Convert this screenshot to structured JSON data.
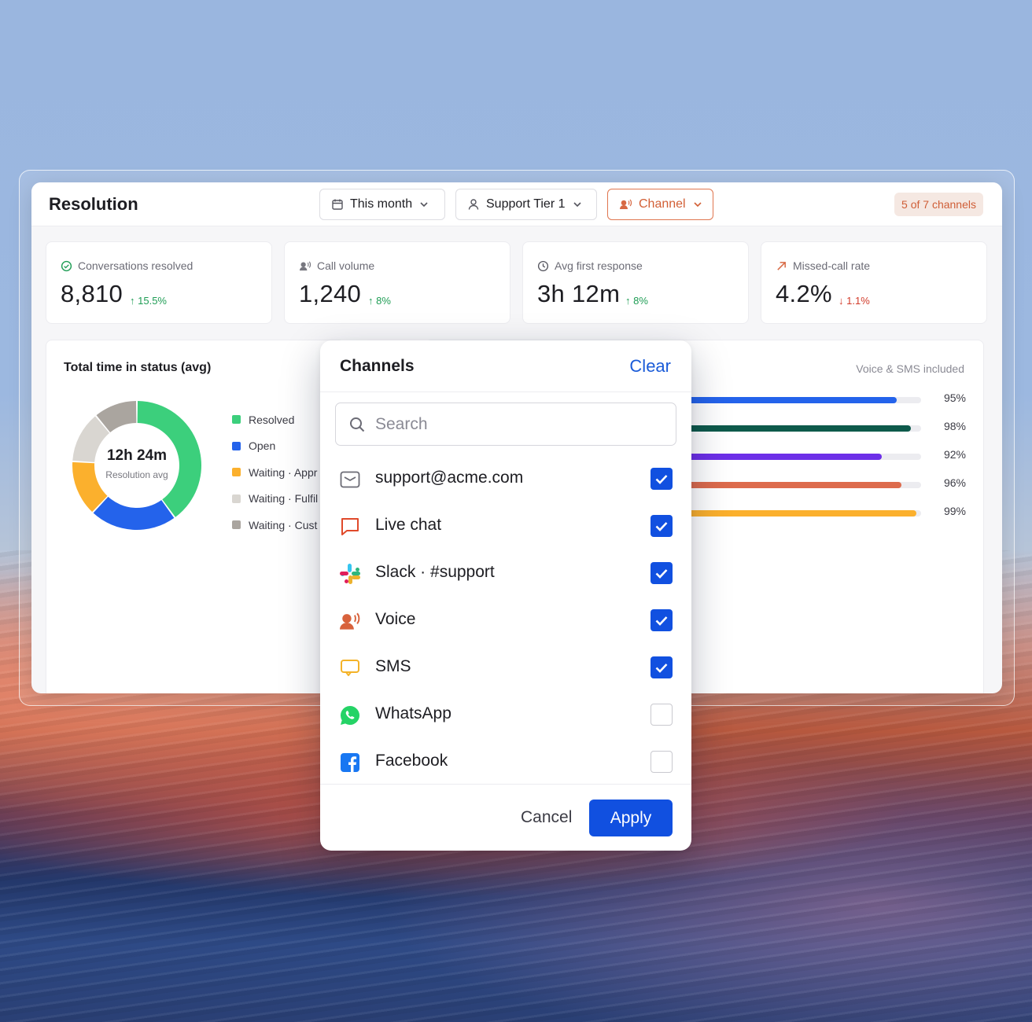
{
  "header": {
    "title": "Resolution",
    "filters": {
      "date": "This month",
      "team": "Support Tier 1",
      "channel": "Channel"
    },
    "channel_badge": "5 of 7 channels"
  },
  "kpis": [
    {
      "label": "Conversations resolved",
      "value": "8,810",
      "delta": "15.5%",
      "direction": "up",
      "icon": "check-circle-icon"
    },
    {
      "label": "Call volume",
      "value": "1,240",
      "delta": "8%",
      "direction": "up",
      "icon": "voice-icon"
    },
    {
      "label": "Avg first response",
      "value": "3h 12m",
      "delta": "8%",
      "direction": "up",
      "icon": "clock-icon"
    },
    {
      "label": "Missed-call rate",
      "value": "4.2%",
      "delta": "1.1%",
      "direction": "down",
      "icon": "arrow-up-right-icon"
    }
  ],
  "status_panel": {
    "title": "Total time in status (avg)",
    "center_value": "12h 24m",
    "center_label": "Resolution avg",
    "legend": [
      {
        "label": "Resolved",
        "color": "#3ccf7c"
      },
      {
        "label": "Open",
        "color": "#2463eb"
      },
      {
        "label": "Waiting · Appr",
        "color": "#fbb02d"
      },
      {
        "label": "Waiting · Fulfil",
        "color": "#d9d6d1"
      },
      {
        "label": "Waiting · Cust",
        "color": "#aaa59f"
      }
    ]
  },
  "chart_data": {
    "type": "pie",
    "categories": [
      "Resolved",
      "Open",
      "Waiting · Appr",
      "Waiting · Fulfil",
      "Waiting · Cust"
    ],
    "values": [
      40,
      22,
      14,
      13,
      11
    ],
    "colors": [
      "#3ccf7c",
      "#2463eb",
      "#fbb02d",
      "#d9d6d1",
      "#aaa59f"
    ]
  },
  "channel_panel": {
    "note": "Voice & SMS included",
    "bars": [
      {
        "value": 95,
        "label": "95%",
        "color": "#2463eb"
      },
      {
        "value": 98,
        "label": "98%",
        "color": "#0e5a4b"
      },
      {
        "value": 92,
        "label": "92%",
        "color": "#6d2fe8"
      },
      {
        "value": 96,
        "label": "96%",
        "color": "#dd6b4c"
      },
      {
        "value": 99,
        "label": "99%",
        "color": "#fbb02d"
      }
    ]
  },
  "dropdown": {
    "title": "Channels",
    "clear_label": "Clear",
    "search_placeholder": "Search",
    "options": [
      {
        "label": "support@acme.com",
        "checked": true,
        "icon": "envelope-icon"
      },
      {
        "label": "Live chat",
        "checked": true,
        "icon": "chat-bubble-icon"
      },
      {
        "label": "Slack · #support",
        "checked": true,
        "icon": "slack-icon"
      },
      {
        "label": "Voice",
        "checked": true,
        "icon": "voice-icon"
      },
      {
        "label": "SMS",
        "checked": true,
        "icon": "sms-icon"
      },
      {
        "label": "WhatsApp",
        "checked": false,
        "icon": "whatsapp-icon"
      },
      {
        "label": "Facebook",
        "checked": false,
        "icon": "facebook-icon"
      }
    ],
    "cancel_label": "Cancel",
    "apply_label": "Apply"
  },
  "colors": {
    "accent": "#1150e0",
    "channel_active": "#d25f35",
    "positive": "#1f9d55",
    "negative": "#d23b2a"
  }
}
